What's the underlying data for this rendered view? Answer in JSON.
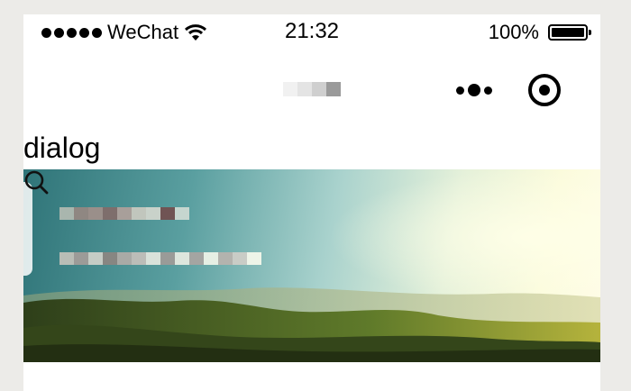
{
  "status_bar": {
    "carrier": "WeChat",
    "time": "21:32",
    "battery_percent_label": "100%",
    "battery_level": 1.0
  },
  "nav": {
    "title_pixelated": true,
    "more_icon": "more-dots-icon",
    "close_icon": "target-circle-icon"
  },
  "page": {
    "title": "dialog"
  },
  "banner": {
    "title_pixelated": true,
    "subtitle_pixelated": true,
    "search_icon": "search-icon"
  },
  "colors": {
    "background": "#ecebe8",
    "screen": "#ffffff",
    "text": "#000000",
    "sky_teal": "#2f7478",
    "sky_light": "#fbfbdc",
    "hills": "#3c4d1e"
  }
}
